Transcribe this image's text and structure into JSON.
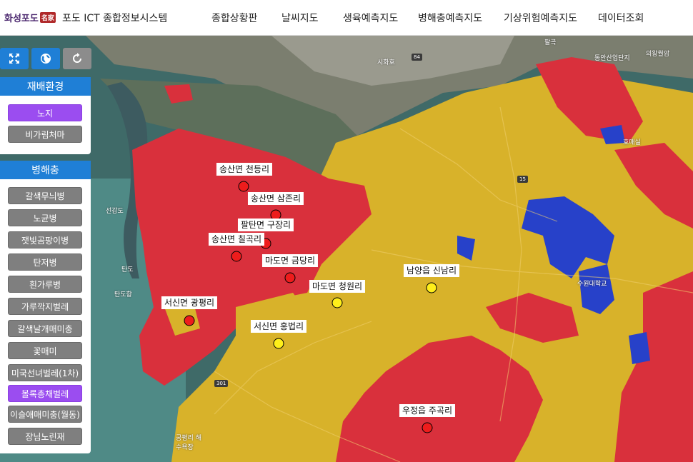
{
  "header": {
    "logo_text": "화성포도",
    "logo_seal": "名家",
    "app_title": "포도 ICT 종합정보시스템",
    "nav": [
      "종합상황판",
      "날씨지도",
      "생육예측지도",
      "병해충예측지도",
      "기상위험예측지도",
      "데이터조회"
    ]
  },
  "colors": {
    "accent": "#1f7fd6",
    "active_button": "#9b4df0",
    "inactive_button": "#7f7f7f",
    "risk_high": "#e0263a",
    "risk_mid": "#e8b62a",
    "risk_low": "#1f3fd6"
  },
  "controls": [
    {
      "name": "fullscreen-icon",
      "style": "blue"
    },
    {
      "name": "globe-icon",
      "style": "blue"
    },
    {
      "name": "refresh-icon",
      "style": "grey"
    }
  ],
  "environment_panel": {
    "title": "재배환경",
    "buttons": [
      {
        "label": "노지",
        "active": true
      },
      {
        "label": "비가림처마",
        "active": false
      }
    ]
  },
  "disease_panel": {
    "title": "병해충",
    "buttons": [
      {
        "label": "갈색무늬병",
        "active": false
      },
      {
        "label": "노균병",
        "active": false
      },
      {
        "label": "잿빛곰팡이병",
        "active": false
      },
      {
        "label": "탄저병",
        "active": false
      },
      {
        "label": "흰가루병",
        "active": false
      },
      {
        "label": "가루깍지벌레",
        "active": false
      },
      {
        "label": "갈색날개매미충",
        "active": false
      },
      {
        "label": "꽃매미",
        "active": false
      },
      {
        "label": "미국선녀벌레(1차)",
        "active": false
      },
      {
        "label": "볼록총채벌레",
        "active": true
      },
      {
        "label": "이슬애매미충(월동)",
        "active": false
      },
      {
        "label": "장님노린재",
        "active": false
      }
    ]
  },
  "markers": [
    {
      "label": "송산면 천등리",
      "color": "red"
    },
    {
      "label": "송산면 삼존리",
      "color": "red"
    },
    {
      "label": "팔탄면 구장리",
      "color": "red"
    },
    {
      "label": "송산면 칠곡리",
      "color": "red"
    },
    {
      "label": "마도면 금당리",
      "color": "red"
    },
    {
      "label": "마도면 청원리",
      "color": "yellow"
    },
    {
      "label": "남양읍 신남리",
      "color": "yellow"
    },
    {
      "label": "서신면 광평리",
      "color": "red"
    },
    {
      "label": "서신면 홍법리",
      "color": "yellow"
    },
    {
      "label": "우정읍 주곡리",
      "color": "red"
    }
  ],
  "map_labels": {
    "place1": "시화호",
    "place2": "선감도",
    "place3": "탄도",
    "place4": "탄도항",
    "place5": "궁평리 해수욕장",
    "place6": "팔곡",
    "place7": "동안산업단지",
    "place8": "의왕월암",
    "place9": "호매실",
    "place10": "수원대학교",
    "road1": "84",
    "road2": "301",
    "road3": "15"
  }
}
